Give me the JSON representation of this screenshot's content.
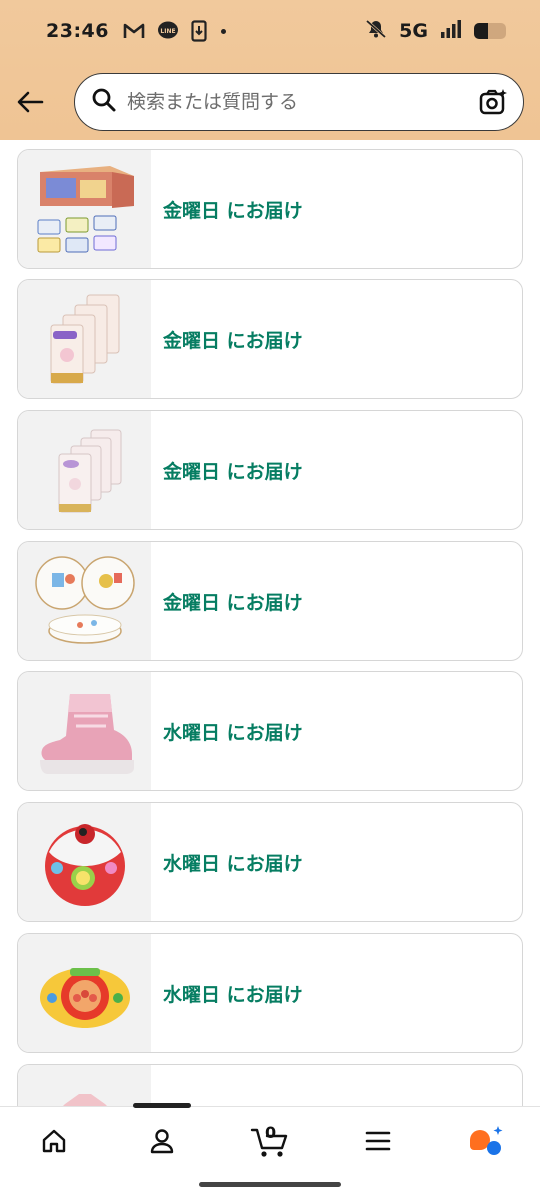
{
  "status_bar": {
    "time": "23:46",
    "icons": [
      "gmail-icon",
      "line-icon",
      "download-icon",
      "dot-icon"
    ],
    "network": "5G",
    "battery_level": 0.45
  },
  "header": {
    "search_placeholder": "検索または質問する"
  },
  "items": [
    {
      "delivery": "金曜日 にお届け",
      "image": "diaper-wipes-box-image"
    },
    {
      "delivery": "金曜日 にお届け",
      "image": "merries-diaper-packs-image"
    },
    {
      "delivery": "金曜日 にお届け",
      "image": "diaper-packs-image"
    },
    {
      "delivery": "金曜日 にお届け",
      "image": "baby-plates-image"
    },
    {
      "delivery": "水曜日 にお届け",
      "image": "pink-snow-boots-image"
    },
    {
      "delivery": "水曜日 にお届け",
      "image": "baby-ball-toy-image"
    },
    {
      "delivery": "水曜日 にお届け",
      "image": "anpanman-steering-toy-image"
    },
    {
      "delivery": "",
      "image": "pink-clothing-image"
    }
  ],
  "bottom_nav": {
    "cart_count": "0",
    "items": [
      "home-icon",
      "account-icon",
      "cart-icon",
      "menu-icon",
      "rufus-ai-icon"
    ]
  },
  "colors": {
    "header_bg": "#f1c99c",
    "delivery_text": "#067d62",
    "ai_orange": "#ff6f1f",
    "ai_blue": "#1a73e8"
  }
}
